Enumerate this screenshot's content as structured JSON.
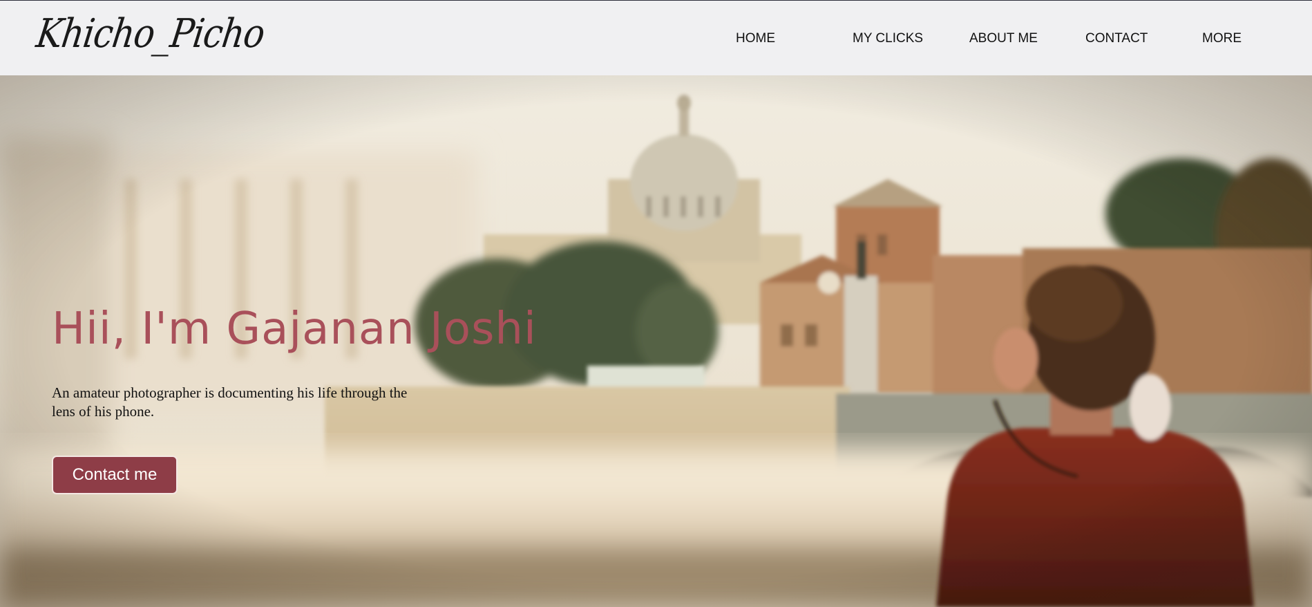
{
  "header": {
    "logo_text": "Khicho_Picho",
    "nav": [
      {
        "label": "HOME"
      },
      {
        "label": "MY CLICKS"
      },
      {
        "label": "ABOUT ME"
      },
      {
        "label": "CONTACT"
      },
      {
        "label": "MORE"
      }
    ]
  },
  "hero": {
    "title": "Hii, I'm Gajanan Joshi",
    "description": "An amateur photographer is documenting his life through the lens of his phone.",
    "cta_label": "Contact me",
    "background_image": "blurred photo of a person photographing St. Peter's dome and a riverside bridge"
  },
  "colors": {
    "header_bg": "#f0f0f2",
    "title": "#a9505a",
    "button_bg": "#8e3d47",
    "button_text": "#ffffff"
  }
}
